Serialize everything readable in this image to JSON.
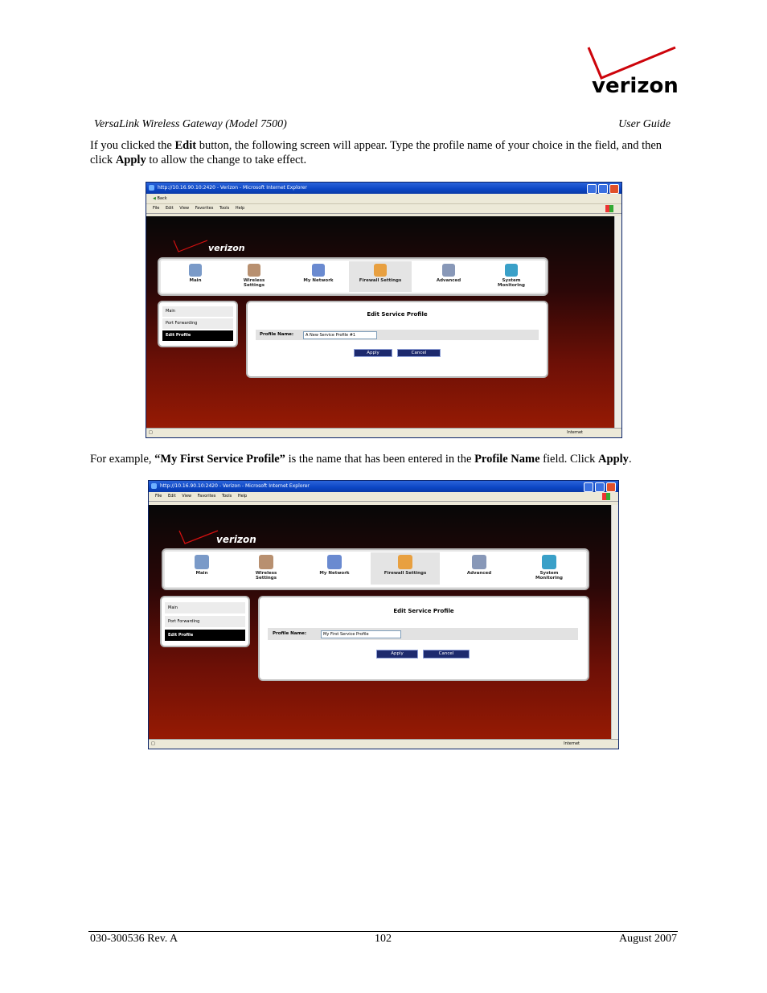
{
  "brand": {
    "logo_text": "verizon"
  },
  "header": {
    "left": "VersaLink Wireless Gateway (Model 7500)",
    "right": "User Guide"
  },
  "intro": {
    "part1": "If you clicked the ",
    "bold1": "Edit",
    "part2": " button, the following screen will appear. Type the profile name of your choice in the field, and then click ",
    "bold2": "Apply",
    "part3": " to allow the change to take effect."
  },
  "example": {
    "part1": "For example, ",
    "bold1": "“My First Service Profile”",
    "part2": " is the name that has been entered in the ",
    "bold2": "Profile Name",
    "part3": " field. Click ",
    "bold3": "Apply",
    "part4": "."
  },
  "browser": {
    "title": "http://10.16.90.10:2420 - Verizon - Microsoft Internet Explorer",
    "toolbar_back": "Back",
    "menu": [
      "File",
      "Edit",
      "View",
      "Favorites",
      "Tools",
      "Help"
    ],
    "status_zone": "Internet",
    "logo_text": "verizon",
    "nav": [
      {
        "label": "Main",
        "icon": "main-icon",
        "color": "#7a9ac8"
      },
      {
        "label": "Wireless Settings",
        "icon": "wireless-icon",
        "color": "#b89070"
      },
      {
        "label": "My Network",
        "icon": "network-icon",
        "color": "#6a8ad0"
      },
      {
        "label": "Firewall Settings",
        "icon": "firewall-icon",
        "color": "#e8a040"
      },
      {
        "label": "Advanced",
        "icon": "advanced-icon",
        "color": "#8898b8"
      },
      {
        "label": "System Monitoring",
        "icon": "monitor-icon",
        "color": "#3aa0c8"
      }
    ],
    "left_menu": [
      "Main",
      "Port Forwarding",
      "Edit Profile"
    ],
    "form_title": "Edit Service Profile",
    "field_label": "Profile Name:",
    "apply": "Apply",
    "cancel": "Cancel"
  },
  "screens": [
    {
      "value": "A New Service Profile #1"
    },
    {
      "value": "My First Service Profile"
    }
  ],
  "footer": {
    "left": "030-300536 Rev. A",
    "center": "102",
    "right": "August 2007"
  }
}
